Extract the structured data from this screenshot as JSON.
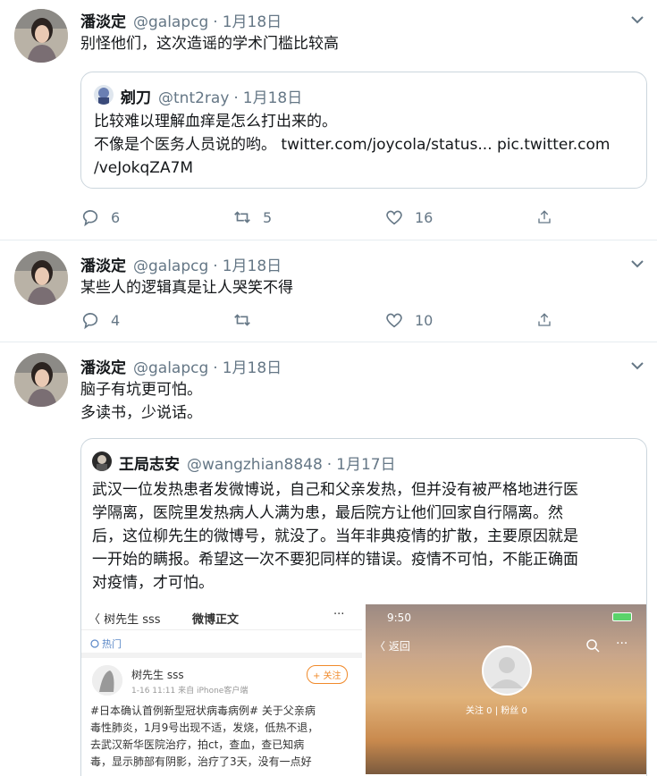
{
  "tweets": [
    {
      "name": "潘淡定",
      "handle": "@galapcg",
      "dot": "·",
      "date": "1月18日",
      "text": "别怪他们，这次造谣的学术门槛比较高",
      "quote": {
        "name": "剜刀",
        "handle": "@tnt2ray",
        "dot": "·",
        "date": "1月18日",
        "text": "比较难以理解血痒是怎么打出来的。\n不像是个医务人员说的哟。 twitter.com/joycola/status... pic.twitter.com\n/veJokqZA7M"
      },
      "actions": {
        "reply": "6",
        "retweet": "5",
        "like": "16"
      }
    },
    {
      "name": "潘淡定",
      "handle": "@galapcg",
      "dot": "·",
      "date": "1月18日",
      "text": "某些人的逻辑真是让人哭笑不得",
      "actions": {
        "reply": "4",
        "retweet": "",
        "like": "10"
      }
    },
    {
      "name": "潘淡定",
      "handle": "@galapcg",
      "dot": "·",
      "date": "1月18日",
      "text": "脑子有坑更可怕。\n多读书，少说话。",
      "quote": {
        "name": "王局志安",
        "handle": "@wangzhian8848",
        "dot": "·",
        "date": "1月17日",
        "text": "武汉一位发热患者发微博说，自己和父亲发热，但并没有被严格地进行医\n学隔离，医院里发热病人人满为患，最后院方让他们回家自行隔离。然\n后，这位柳先生的微博号，就没了。当年非典疫情的扩散，主要原因就是\n一开始的瞒报。希望这一次不要犯同样的错误。疫情不可怕，不能正确面\n对疫情，才可怕。",
        "media_left": {
          "back": "〈 树先生 sss",
          "title": "微博正文",
          "more": "···",
          "hot": "热门",
          "user": "树先生 sss",
          "follow": "+ 关注",
          "meta": "1-16 11:11  来自 iPhone客户端",
          "post": "#日本确认首例新型冠状病毒病例# 关于父亲病\n毒性肺炎，1月9号出现不适，发烧，低热不退，\n去武汉新华医院治疗，拍ct，查血，查已知病\n毒，显示肺部有阴影，治疗了3天，没有一点好"
        },
        "media_right": {
          "time": "9:50",
          "back": "〈 返回",
          "stats": "关注 0  |  粉丝 0"
        }
      }
    }
  ]
}
